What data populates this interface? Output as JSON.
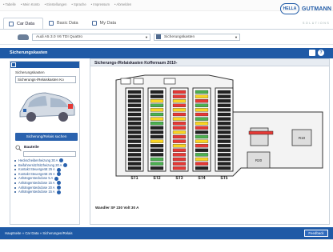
{
  "top_links": [
    "• Tabelle",
    "• Mein Konto",
    "• Einstellungen",
    "• Sprache",
    "• Impressum",
    "• Abmelden"
  ],
  "logo": {
    "badge": "HELLA",
    "name": "GUTMANN",
    "sub": "SOLUTIONS"
  },
  "tabs": [
    {
      "label": "Car Data"
    },
    {
      "label": "Basic Data"
    },
    {
      "label": "My Data"
    }
  ],
  "vehicle": {
    "model": "Audi A5 3.0 V6 TDI Quattro"
  },
  "fusebox": {
    "selected": "Sicherungskasten"
  },
  "page_title": "Sicherungskasten",
  "left": {
    "select_label": "Sicherungskasten",
    "select_value": "Sicherungs-/Relaiskasten Ko",
    "search_button": "Sicherung/Relais suchen",
    "components_label": "Bauteile",
    "components": [
      "Heckscheibenheizung 30 A",
      "Beifahrersitz/Sitzheizung 20 A",
      "Kontakt Steuergerät 25 A",
      "Kontakt Steuergerät 25 A",
      "Anhängersteckdose 5 A",
      "Anhängersteckdose 15 A",
      "Anhängersteckdose 20 A",
      "Anhängersteckdose 15 A"
    ]
  },
  "main": {
    "title": "Sicherungs-/Relaiskasten Kofferraum 2010-",
    "footnote": "Wandler SF 230 Volt 30 A",
    "strip_labels": [
      "ST1",
      "ST2",
      "ST3",
      "ST4",
      "ST5"
    ],
    "relay_labels": [
      "R10",
      "R20"
    ]
  },
  "status": {
    "breadcrumb": "Hauptseite » Car Data » Sicherungen/Relais",
    "feedback": "Feedback"
  },
  "colors": {
    "primary": "#1f5aa6",
    "fuse_green": "#4caf50",
    "fuse_red": "#e53935",
    "fuse_yellow": "#f9d423"
  }
}
